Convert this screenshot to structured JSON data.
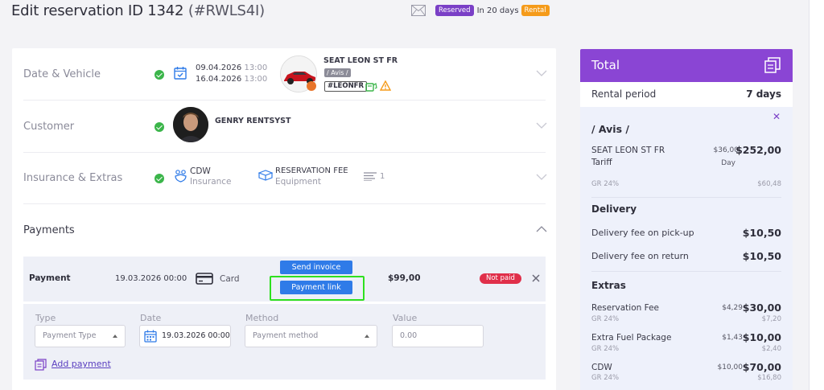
{
  "header": {
    "title": "Edit reservation ID 1342",
    "code": "(#RWLS4I)",
    "status_badge": "Reserved",
    "days_text": "In 20 days",
    "type_badge": "Rental"
  },
  "sections": {
    "date_vehicle": {
      "label": "Date & Vehicle",
      "start_date": "09.04.2026",
      "start_time": "13:00",
      "end_date": "16.04.2026",
      "end_time": "13:00",
      "vehicle_name": "SEAT LEON ST FR",
      "vehicle_group": "/ Avis /",
      "plate": "#LEONFR"
    },
    "customer": {
      "label": "Customer",
      "name": "GENRY RENTSYST"
    },
    "insurance_extras": {
      "label": "Insurance & Extras",
      "insurance_name": "CDW",
      "insurance_sub": "Insurance",
      "extra_name": "RESERVATION FEE",
      "extra_sub": "Equipment",
      "list_count": "1"
    },
    "payments": {
      "label": "Payments",
      "payment": {
        "label": "Payment",
        "date": "19.03.2026 00:00",
        "method": "Card",
        "send_invoice": "Send invoice",
        "payment_link": "Payment link",
        "amount": "$99,00",
        "status": "Not paid"
      },
      "form": {
        "type_label": "Type",
        "type_placeholder": "Payment Type",
        "date_label": "Date",
        "date_value": "19.03.2026 00:00",
        "method_label": "Method",
        "method_placeholder": "Payment method",
        "value_label": "Value",
        "value_placeholder": "0.00",
        "add_payment": "Add payment"
      }
    }
  },
  "total": {
    "title": "Total",
    "rental_period_label": "Rental period",
    "rental_period_value": "7 days",
    "group": "/ Avis /",
    "vehicle_line1": "SEAT LEON ST FR",
    "vehicle_line2": "Tariff",
    "vehicle_unit": "$36,00",
    "vehicle_unit_label": "Day",
    "vehicle_amount": "$252,00",
    "vehicle_tax_label": "GR 24%",
    "vehicle_tax": "$60,48",
    "delivery_title": "Delivery",
    "delivery_items": [
      {
        "label": "Delivery fee on pick-up",
        "amount": "$10,50"
      },
      {
        "label": "Delivery fee on return",
        "amount": "$10,50"
      }
    ],
    "extras_title": "Extras",
    "extras_items": [
      {
        "label": "Reservation Fee",
        "tax_label": "GR 24%",
        "unit": "$4,29",
        "amount": "$30,00",
        "tax": "$7,20"
      },
      {
        "label": "Extra Fuel Package",
        "tax_label": "GR 24%",
        "unit": "$1,43",
        "amount": "$10,00",
        "tax": "$2,40"
      },
      {
        "label": "CDW",
        "tax_label": "GR 24%",
        "unit": "$10,00",
        "amount": "$70,00",
        "tax": "$16,80"
      }
    ]
  },
  "colors": {
    "accent_purple": "#8a45d4",
    "badge_reserved": "#7a3fc6",
    "badge_rental": "#f59b1a",
    "button_blue": "#2f7be8",
    "not_paid_red": "#e02f4a",
    "check_green": "#3bb54a",
    "highlight_green": "#2ee01f"
  },
  "icons": [
    "mail-icon",
    "calendar-check-icon",
    "check-icon",
    "chevron-down-icon",
    "chevron-up-icon",
    "fuel-icon",
    "warning-icon",
    "shield-people-icon",
    "box-icon",
    "list-icon",
    "card-icon",
    "close-icon",
    "copy-icon",
    "calendar-icon",
    "add-payment-icon"
  ]
}
